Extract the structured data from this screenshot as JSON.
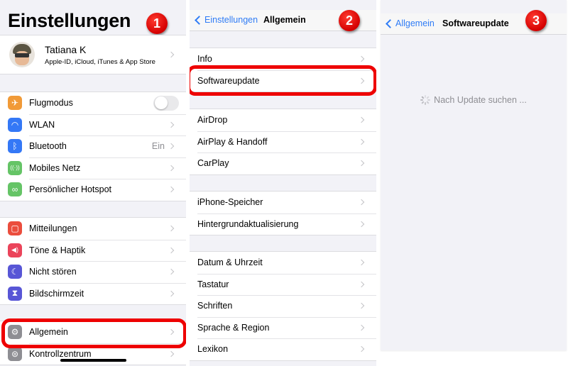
{
  "panel1": {
    "title": "Einstellungen",
    "callout": "1",
    "profile": {
      "name": "Tatiana K",
      "subtitle": "Apple-ID, iCloud, iTunes & App Store"
    },
    "group1": [
      {
        "label": "Flugmodus",
        "icon": "airplane-icon",
        "color": "#f19a37",
        "toggle": false
      },
      {
        "label": "WLAN",
        "icon": "wifi-icon",
        "color": "#3478f6"
      },
      {
        "label": "Bluetooth",
        "icon": "bluetooth-icon",
        "color": "#3478f6",
        "detail": "Ein"
      },
      {
        "label": "Mobiles Netz",
        "icon": "antenna-icon",
        "color": "#65c466"
      },
      {
        "label": "Persönlicher Hotspot",
        "icon": "hotspot-icon",
        "color": "#65c466"
      }
    ],
    "group2": [
      {
        "label": "Mitteilungen",
        "icon": "notifications-icon",
        "color": "#eb4d3d"
      },
      {
        "label": "Töne & Haptik",
        "icon": "speaker-icon",
        "color": "#eb445a"
      },
      {
        "label": "Nicht stören",
        "icon": "moon-icon",
        "color": "#5856d6"
      },
      {
        "label": "Bildschirmzeit",
        "icon": "hourglass-icon",
        "color": "#5856d6"
      }
    ],
    "group3": [
      {
        "label": "Allgemein",
        "icon": "gear-icon",
        "color": "#8e8e93"
      },
      {
        "label": "Kontrollzentrum",
        "icon": "switches-icon",
        "color": "#8e8e93"
      }
    ]
  },
  "panel2": {
    "back": "Einstellungen",
    "title": "Allgemein",
    "callout": "2",
    "group1": [
      "Info",
      "Softwareupdate"
    ],
    "group2": [
      "AirDrop",
      "AirPlay & Handoff",
      "CarPlay"
    ],
    "group3": [
      "iPhone-Speicher",
      "Hintergrundaktualisierung"
    ],
    "group4": [
      "Datum & Uhrzeit",
      "Tastatur",
      "Schriften",
      "Sprache & Region",
      "Lexikon"
    ]
  },
  "panel3": {
    "back": "Allgemein",
    "title": "Softwareupdate",
    "callout": "3",
    "status": "Nach Update suchen ..."
  }
}
